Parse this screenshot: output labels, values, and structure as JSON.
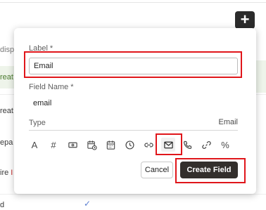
{
  "background": {
    "add_button_symbol": "+",
    "rows": [
      {
        "text": "displ",
        "style": "gray"
      },
      {
        "text": "reat",
        "style": "green"
      },
      {
        "text": "reat",
        "style": "dark"
      },
      {
        "text": "epa",
        "style": "dark"
      },
      {
        "text": "ire",
        "marker": "I",
        "style": "dark"
      },
      {
        "text": "d",
        "style": "dark"
      }
    ],
    "checkmark": "✓"
  },
  "dialog": {
    "label_field": {
      "label": "Label",
      "required_mark": "*",
      "value": "Email"
    },
    "field_name": {
      "label": "Field Name",
      "required_mark": "*",
      "value": "email"
    },
    "type": {
      "label": "Type",
      "selected_value": "Email"
    },
    "type_options": [
      {
        "name": "text",
        "glyph": "A"
      },
      {
        "name": "number",
        "glyph": "#"
      },
      {
        "name": "currency",
        "glyph": ""
      },
      {
        "name": "datetime",
        "glyph": ""
      },
      {
        "name": "date",
        "glyph": ""
      },
      {
        "name": "time",
        "glyph": ""
      },
      {
        "name": "link",
        "glyph": ""
      },
      {
        "name": "email",
        "glyph": "",
        "selected": true
      },
      {
        "name": "phone",
        "glyph": ""
      },
      {
        "name": "url",
        "glyph": ""
      },
      {
        "name": "percent",
        "glyph": "%"
      }
    ],
    "cancel_label": "Cancel",
    "create_label": "Create Field"
  },
  "colors": {
    "highlight": "#e0161b",
    "primary_button": "#332f2c",
    "row_highlight": "#eef4ea"
  }
}
